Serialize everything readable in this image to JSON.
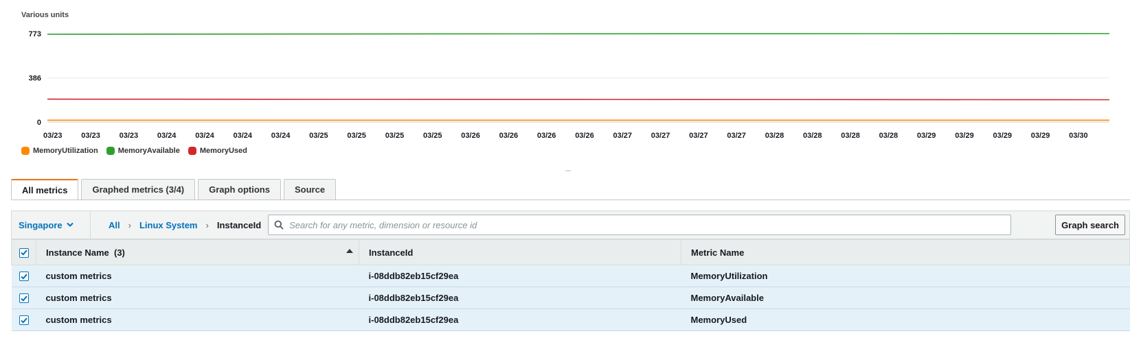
{
  "chart": {
    "unit_label": "Various units",
    "colors": {
      "MemoryUtilization": "#ff8a00",
      "MemoryAvailable": "#2ca02c",
      "MemoryUsed": "#d62728"
    }
  },
  "chart_data": {
    "type": "line",
    "ylabel": "Various units",
    "ylim": [
      0,
      773
    ],
    "yticks": [
      "773",
      "386",
      "0"
    ],
    "ytick_values": [
      773,
      386,
      0
    ],
    "x_ticks": [
      "03/23",
      "03/23",
      "03/23",
      "03/24",
      "03/24",
      "03/24",
      "03/24",
      "03/25",
      "03/25",
      "03/25",
      "03/25",
      "03/26",
      "03/26",
      "03/26",
      "03/26",
      "03/27",
      "03/27",
      "03/27",
      "03/27",
      "03/28",
      "03/28",
      "03/28",
      "03/28",
      "03/29",
      "03/29",
      "03/29",
      "03/29",
      "03/30"
    ],
    "grid": true,
    "legend_position": "bottom-left",
    "series": [
      {
        "name": "MemoryUtilization",
        "color": "#ff8a00",
        "values": [
          16,
          16,
          16
        ]
      },
      {
        "name": "MemoryAvailable",
        "color": "#2ca02c",
        "values": [
          767,
          771,
          773
        ]
      },
      {
        "name": "MemoryUsed",
        "color": "#d62728",
        "values": [
          200,
          197,
          195
        ]
      }
    ]
  },
  "tabs": [
    {
      "label": "All metrics",
      "active": true
    },
    {
      "label": "Graphed metrics (3/4)",
      "active": false
    },
    {
      "label": "Graph options",
      "active": false
    },
    {
      "label": "Source",
      "active": false
    }
  ],
  "browse": {
    "region": "Singapore",
    "breadcrumb": [
      "All",
      "Linux System",
      "InstanceId"
    ],
    "search_placeholder": "Search for any metric, dimension or resource id",
    "graph_search_label": "Graph search"
  },
  "table": {
    "columns": [
      "Instance Name  (3)",
      "InstanceId",
      "Metric Name"
    ],
    "rows": [
      {
        "name": "custom metrics",
        "instance_id": "i-08ddb82eb15cf29ea",
        "metric": "MemoryUtilization"
      },
      {
        "name": "custom metrics",
        "instance_id": "i-08ddb82eb15cf29ea",
        "metric": "MemoryAvailable"
      },
      {
        "name": "custom metrics",
        "instance_id": "i-08ddb82eb15cf29ea",
        "metric": "MemoryUsed"
      }
    ]
  }
}
